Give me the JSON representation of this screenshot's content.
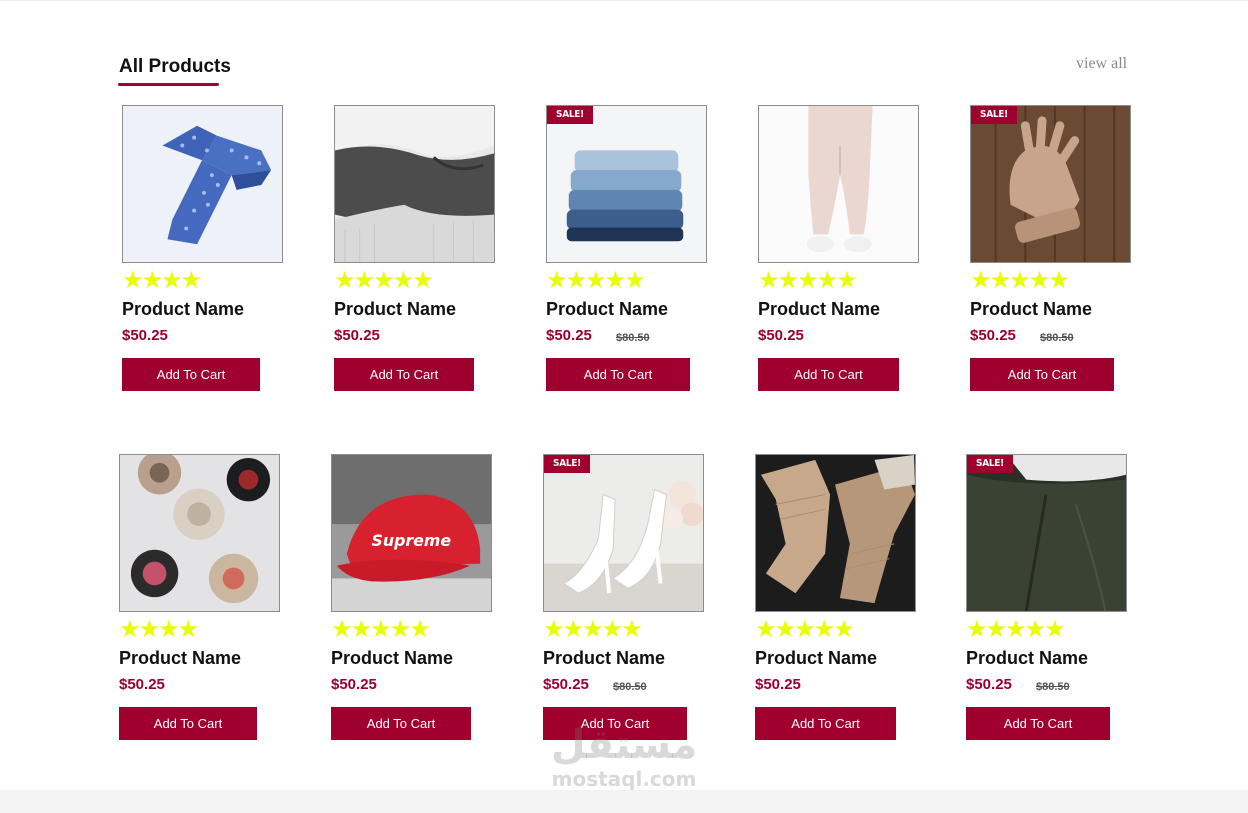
{
  "section": {
    "title": "All Products",
    "view_all": "view all"
  },
  "colors": {
    "accent": "#a0002e",
    "star": "#e8ff00",
    "price": "#9a0030"
  },
  "products": [
    {
      "name": "Product Name",
      "price": "$50.25",
      "old_price": "",
      "sale": false,
      "badge": "",
      "rating": 4,
      "stars": "★★★★",
      "button": "Add To Cart",
      "image": "blue-tie"
    },
    {
      "name": "Product Name",
      "price": "$50.25",
      "old_price": "",
      "sale": false,
      "badge": "",
      "rating": 5,
      "stars": "★★★★★",
      "button": "Add To Cart",
      "image": "knit-sweaters"
    },
    {
      "name": "Product Name",
      "price": "$50.25",
      "old_price": "$80.50",
      "sale": true,
      "badge": "SALE!",
      "rating": 5,
      "stars": "★★★★★",
      "button": "Add To Cart",
      "image": "folded-jeans"
    },
    {
      "name": "Product Name",
      "price": "$50.25",
      "old_price": "",
      "sale": false,
      "badge": "",
      "rating": 5,
      "stars": "★★★★★",
      "button": "Add To Cart",
      "image": "beige-pants"
    },
    {
      "name": "Product Name",
      "price": "$50.25",
      "old_price": "$80.50",
      "sale": true,
      "badge": "SALE!",
      "rating": 5,
      "stars": "★★★★★",
      "button": "Add To Cart",
      "image": "wool-gloves"
    },
    {
      "name": "Product Name",
      "price": "$50.25",
      "old_price": "",
      "sale": false,
      "badge": "",
      "rating": 4,
      "stars": "★★★★",
      "button": "Add To Cart",
      "image": "hats-on-wall"
    },
    {
      "name": "Product Name",
      "price": "$50.25",
      "old_price": "",
      "sale": false,
      "badge": "",
      "rating": 5,
      "stars": "★★★★★",
      "button": "Add To Cart",
      "image": "red-cap"
    },
    {
      "name": "Product Name",
      "price": "$50.25",
      "old_price": "$80.50",
      "sale": true,
      "badge": "SALE!",
      "rating": 5,
      "stars": "★★★★★",
      "button": "Add To Cart",
      "image": "white-heels"
    },
    {
      "name": "Product Name",
      "price": "$50.25",
      "old_price": "",
      "sale": false,
      "badge": "",
      "rating": 5,
      "stars": "★★★★★",
      "button": "Add To Cart",
      "image": "socks"
    },
    {
      "name": "Product Name",
      "price": "$50.25",
      "old_price": "$80.50",
      "sale": true,
      "badge": "SALE!",
      "rating": 5,
      "stars": "★★★★★",
      "button": "Add To Cart",
      "image": "dark-trousers"
    }
  ],
  "watermark": {
    "arabic": "مستقل",
    "latin": "mostaql.com"
  }
}
